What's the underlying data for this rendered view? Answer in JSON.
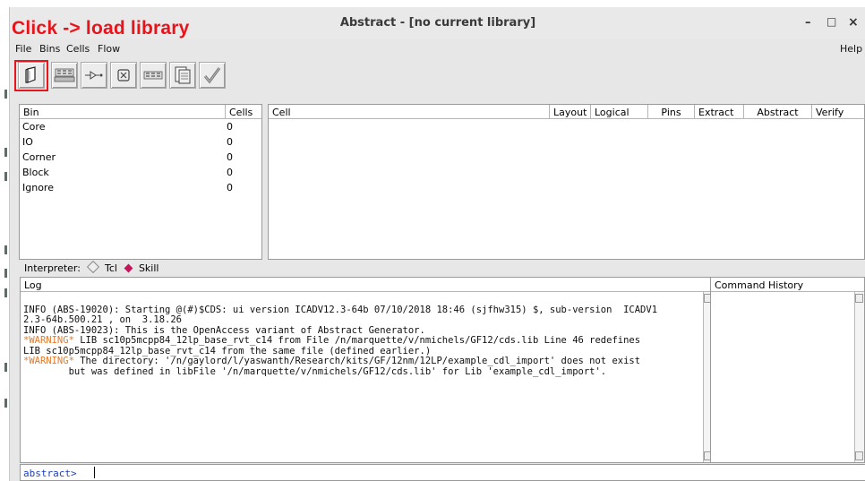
{
  "window": {
    "title": "Abstract - [no current library]",
    "minimize_label": "–",
    "maximize_label": "□",
    "close_label": "×"
  },
  "annotation": {
    "text": "Click -> load library",
    "color": "#e8141c"
  },
  "menu": {
    "items": [
      "File",
      "Bins",
      "Cells",
      "Flow"
    ],
    "help": "Help"
  },
  "toolbar": {
    "buttons": [
      {
        "icon": "open-library-icon",
        "highlighted": true
      },
      {
        "icon": "bin-grid-icon"
      },
      {
        "icon": "pin-icon"
      },
      {
        "icon": "cancel-icon"
      },
      {
        "icon": "layout-cells-icon"
      },
      {
        "icon": "abstract-view-icon"
      },
      {
        "icon": "verify-check-icon"
      }
    ]
  },
  "bins_panel": {
    "headers": {
      "bin": "Bin",
      "cells": "Cells"
    },
    "rows": [
      {
        "name": "Core",
        "count": "0"
      },
      {
        "name": "IO",
        "count": "0"
      },
      {
        "name": "Corner",
        "count": "0"
      },
      {
        "name": "Block",
        "count": "0"
      },
      {
        "name": "Ignore",
        "count": "0"
      }
    ]
  },
  "cells_panel": {
    "headers": [
      "Cell",
      "Layout",
      "Logical",
      "Pins",
      "Extract",
      "Abstract",
      "Verify"
    ]
  },
  "interpreter": {
    "label": "Interpreter:",
    "options": [
      "Tcl",
      "Skill"
    ],
    "selected": "Skill"
  },
  "log": {
    "header": "Log",
    "lines": [
      {
        "text": "INFO (ABS-19020): Starting @(#)$CDS: ui version ICADV12.3-64b 07/10/2018 18:46 (sjfhw315) $, sub-version  ICADV1",
        "prefix": ""
      },
      {
        "text": "2.3-64b.500.21 , on  3.18.26",
        "prefix": ""
      },
      {
        "text": "INFO (ABS-19023): This is the OpenAccess variant of Abstract Generator.",
        "prefix": ""
      },
      {
        "prefix": "*WARNING*",
        "text": " LIB sc10p5mcpp84_12lp_base_rvt_c14 from File /n/marquette/v/nmichels/GF12/cds.lib Line 46 redefines"
      },
      {
        "text": "LIB sc10p5mcpp84_12lp_base_rvt_c14 from the same file (defined earlier.)",
        "prefix": ""
      },
      {
        "prefix": "*WARNING*",
        "text": " The directory: '/n/gaylord/l/yaswanth/Research/kits/GF/12nm/12LP/example_cdl_import' does not exist"
      },
      {
        "text": "        but was defined in libFile '/n/marquette/v/nmichels/GF12/cds.lib' for Lib 'example_cdl_import'.",
        "prefix": ""
      }
    ]
  },
  "command_history": {
    "header": "Command History"
  },
  "command_line": {
    "prompt": "abstract>",
    "value": ""
  }
}
